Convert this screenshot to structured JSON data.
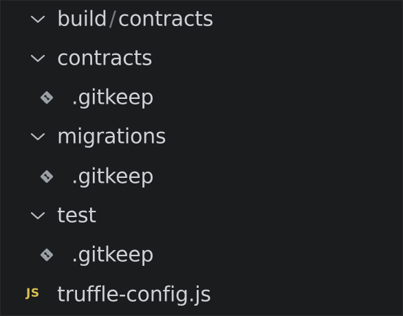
{
  "tree": {
    "items": [
      {
        "type": "folder",
        "expanded": true,
        "label_parts": [
          "build",
          "/",
          "contracts"
        ],
        "icon": "chevron-down-icon"
      },
      {
        "type": "folder",
        "expanded": true,
        "label": "contracts",
        "icon": "chevron-down-icon"
      },
      {
        "type": "file",
        "label": ".gitkeep",
        "icon": "git-file-icon"
      },
      {
        "type": "folder",
        "expanded": true,
        "label": "migrations",
        "icon": "chevron-down-icon"
      },
      {
        "type": "file",
        "label": ".gitkeep",
        "icon": "git-file-icon"
      },
      {
        "type": "folder",
        "expanded": true,
        "label": "test",
        "icon": "chevron-down-icon"
      },
      {
        "type": "file",
        "label": ".gitkeep",
        "icon": "git-file-icon"
      },
      {
        "type": "file",
        "label": "truffle-config.js",
        "icon": "js-file-icon",
        "icon_text": "JS"
      }
    ]
  },
  "colors": {
    "background": "#1b1c1e",
    "text": "#cfd1d4",
    "chevron": "#b9bbbe",
    "git_icon": "#9aa0a6",
    "js_icon": "#d9c24f"
  }
}
